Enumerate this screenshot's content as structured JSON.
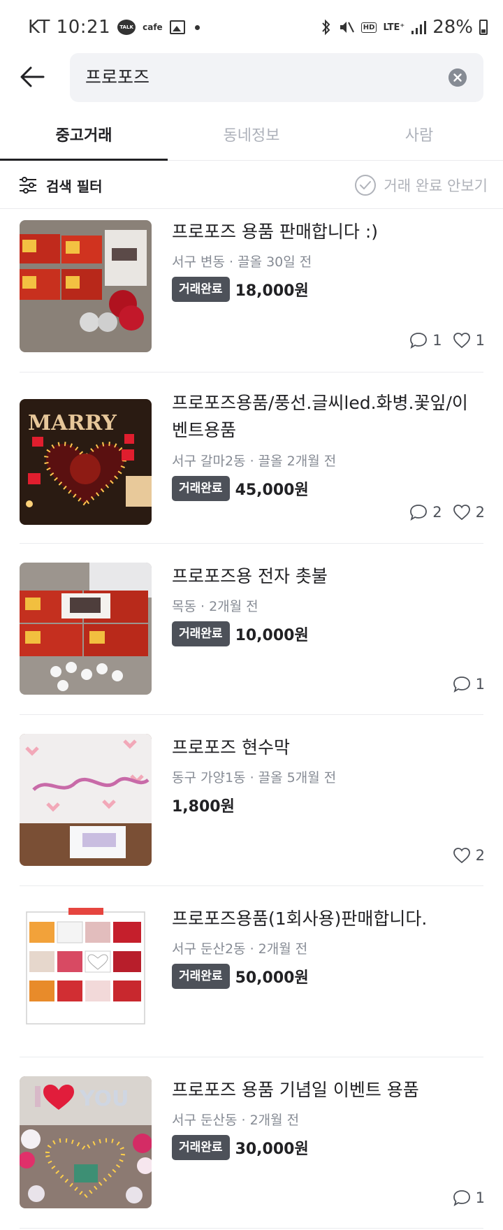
{
  "status_bar": {
    "carrier_time": "KT 10:21",
    "talk": "TALK",
    "cafe": "cafe",
    "hd": "HD",
    "lte": "LTE⁺",
    "battery": "28%"
  },
  "search": {
    "query": "프로포즈"
  },
  "tabs": [
    {
      "label": "중고거래",
      "active": true
    },
    {
      "label": "동네정보",
      "active": false
    },
    {
      "label": "사람",
      "active": false
    }
  ],
  "filter": {
    "label": "검색 필터",
    "hide_completed_label": "거래 완료 안보기"
  },
  "items": [
    {
      "title": "프로포즈 용품 판매합니다 :)",
      "location": "서구 변동",
      "time": "끌올 30일 전",
      "badge": "거래완료",
      "price": "18,000원",
      "comments": "1",
      "likes": "1"
    },
    {
      "title": "프로포즈용품/풍선.글씨led.화병.꽃잎/이벤트용품",
      "location": "서구 갈마2동",
      "time": "끌올 2개월 전",
      "badge": "거래완료",
      "price": "45,000원",
      "comments": "2",
      "likes": "2",
      "image_text": "MARRY"
    },
    {
      "title": "프로포즈용 전자 촛불",
      "location": "목동",
      "time": "2개월 전",
      "badge": "거래완료",
      "price": "10,000원",
      "comments": "1"
    },
    {
      "title": "프로포즈 현수막",
      "location": "동구 가양1동",
      "time": "끌올 5개월 전",
      "price": "1,800원",
      "likes": "2"
    },
    {
      "title": "프로포즈용품(1회사용)판매합니다.",
      "location": "서구 둔산2동",
      "time": "2개월 전",
      "badge": "거래완료",
      "price": "50,000원"
    },
    {
      "title": "프로포즈 용품 기념일 이벤트 용품",
      "location": "서구 둔산동",
      "time": "2개월 전",
      "badge": "거래완료",
      "price": "30,000원",
      "comments": "1"
    }
  ]
}
